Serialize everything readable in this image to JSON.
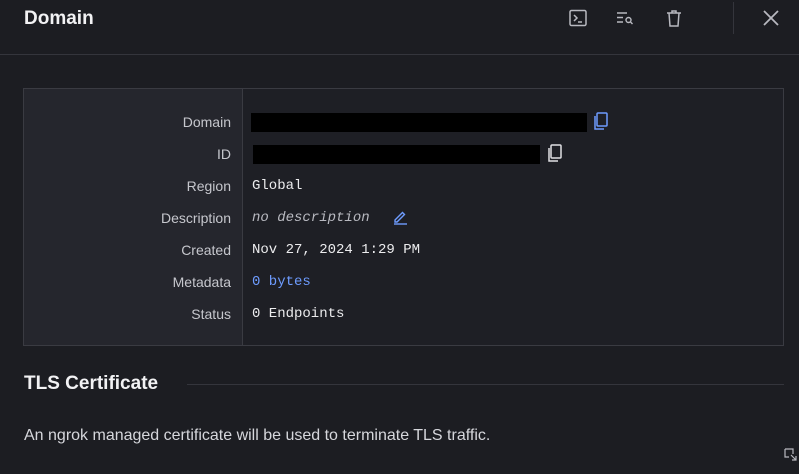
{
  "header": {
    "title": "Domain",
    "icons": [
      "terminal-icon",
      "filter-search-icon",
      "trash-icon",
      "close-icon"
    ]
  },
  "details": {
    "rows": [
      {
        "label": "Domain",
        "value": ""
      },
      {
        "label": "ID",
        "value": ""
      },
      {
        "label": "Region",
        "value": "Global"
      },
      {
        "label": "Description",
        "value": "no description"
      },
      {
        "label": "Created",
        "value": "Nov 27, 2024 1:29 PM"
      },
      {
        "label": "Metadata",
        "value": "0 bytes"
      },
      {
        "label": "Status",
        "value": "0 Endpoints"
      }
    ]
  },
  "tls": {
    "title": "TLS Certificate",
    "description": "An ngrok managed certificate will be used to terminate TLS traffic."
  },
  "colors": {
    "background": "#1c1d22",
    "link": "#6e9cff",
    "border": "#3a3b42"
  }
}
